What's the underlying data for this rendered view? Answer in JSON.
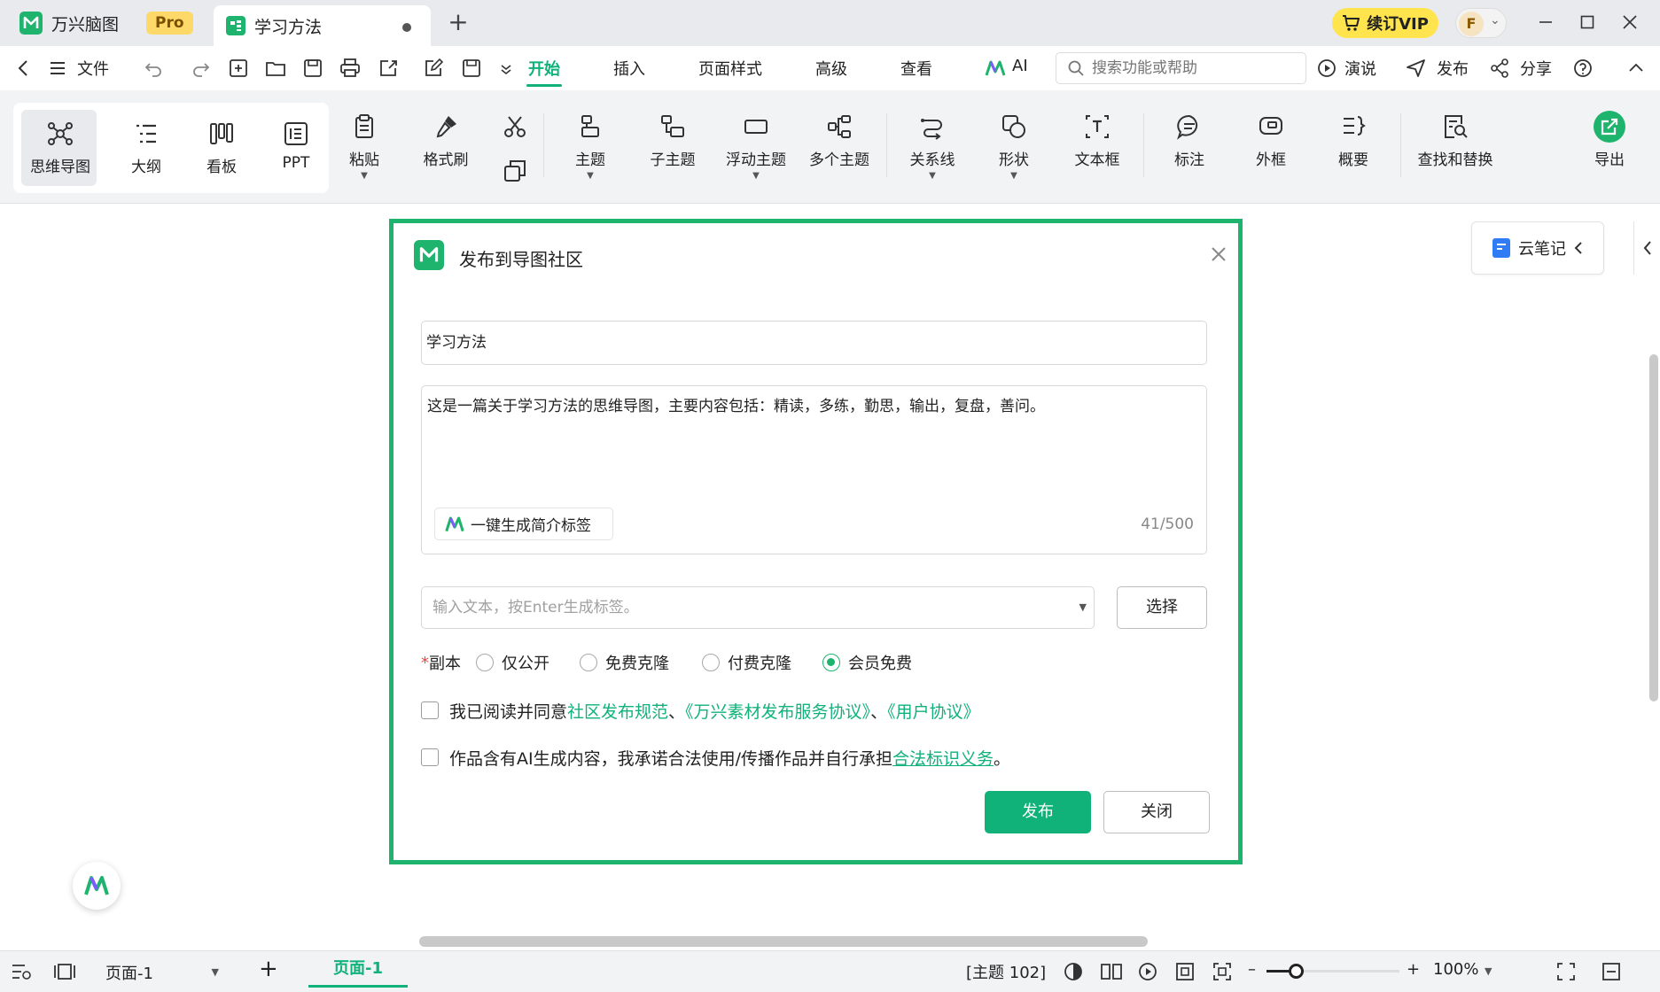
{
  "titlebar": {
    "app_name": "万兴脑图",
    "pro_badge": "Pro",
    "doc_tab": "学习方法",
    "new_tab": "+",
    "vip_label": "续订VIP",
    "avatar_letter": "F"
  },
  "menubar": {
    "file": "文件",
    "tabs": [
      {
        "label": "开始",
        "active": true
      },
      {
        "label": "插入"
      },
      {
        "label": "页面样式"
      },
      {
        "label": "高级"
      },
      {
        "label": "查看"
      }
    ],
    "ai": "AI",
    "search_placeholder": "搜索功能或帮助",
    "present": "演说",
    "publish": "发布",
    "share": "分享"
  },
  "ribbon": {
    "views": [
      "思维导图",
      "大纲",
      "看板",
      "PPT"
    ],
    "paste": "粘贴",
    "format_painter": "格式刷",
    "topic": "主题",
    "subtopic": "子主题",
    "floating_topic": "浮动主题",
    "multi_topic": "多个主题",
    "relation": "关系线",
    "shape": "形状",
    "textbox": "文本框",
    "callout": "标注",
    "boundary": "外框",
    "summary": "概要",
    "find_replace": "查找和替换",
    "export": "导出"
  },
  "canvas": {
    "cloud_note": "云笔记"
  },
  "dialog": {
    "title": "发布到导图社区",
    "name_value": "学习方法",
    "description": "这是一篇关于学习方法的思维导图，主要内容包括：精读，多练，勤思，输出，复盘，善问。",
    "generate_button": "一键生成简介标签",
    "counter": "41/500",
    "tag_placeholder": "输入文本，按Enter生成标签。",
    "select_button": "选择",
    "copy_label": "副本",
    "copy_options": [
      {
        "label": "仅公开",
        "selected": false
      },
      {
        "label": "免费克隆",
        "selected": false
      },
      {
        "label": "付费克隆",
        "selected": false
      },
      {
        "label": "会员免费",
        "selected": true
      }
    ],
    "agree_prefix": "我已阅读并同意",
    "agree_link1": "社区发布规范",
    "agree_sep1": "、",
    "agree_link2": "《万兴素材发布服务协议》",
    "agree_sep2": "、",
    "agree_link3": "《用户协议》",
    "ai_prefix": "作品含有AI生成内容，我承诺合法使用/传播作品并自行承担",
    "ai_link": "合法标识义务",
    "ai_suffix": "。",
    "publish_button": "发布",
    "close_button": "关闭"
  },
  "statusbar": {
    "page_select": "页面-1",
    "add_page": "+",
    "page_tab": "页面-1",
    "topic_count": "[主题 102]",
    "zoom_minus": "–",
    "zoom_plus": "+",
    "zoom_level": "100%",
    "zoom_fraction": 0.22
  },
  "colors": {
    "accent": "#10b27a",
    "brand": "#1fb46e",
    "vip": "#ffe44d"
  }
}
